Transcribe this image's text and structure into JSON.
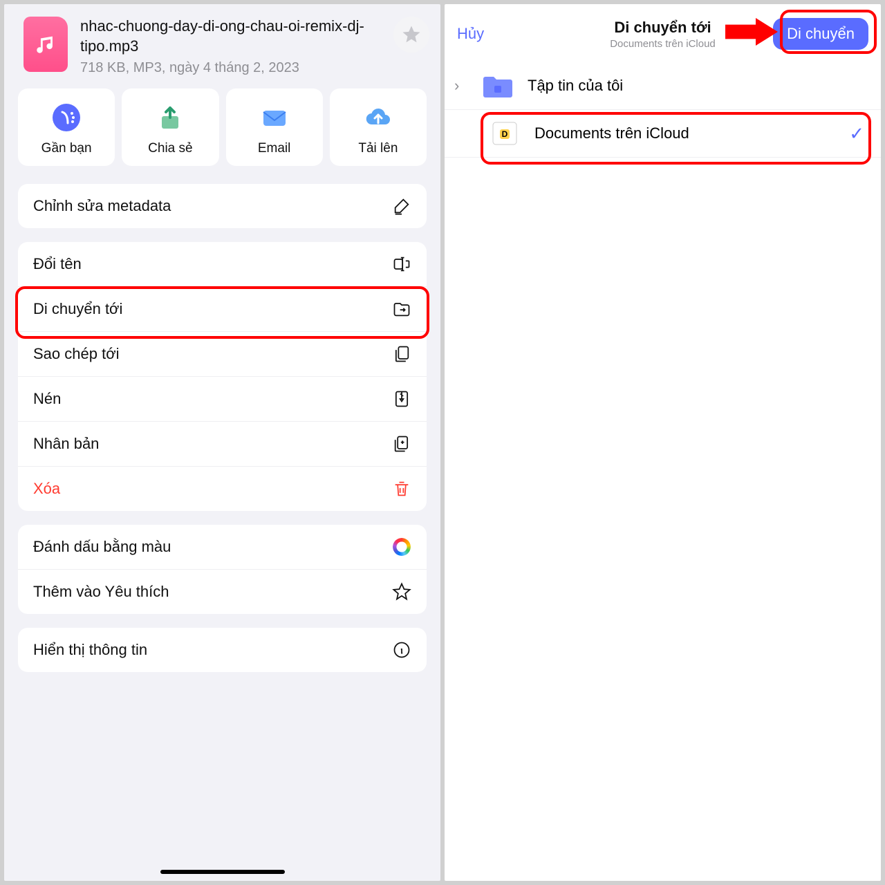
{
  "left": {
    "file": {
      "name": "nhac-chuong-day-di-ong-chau-oi-remix-dj-tipo.mp3",
      "sub": "718 KB, MP3, ngày 4 tháng 2, 2023"
    },
    "actions": {
      "nearby": "Gần bạn",
      "share": "Chia sẻ",
      "email": "Email",
      "upload": "Tải lên"
    },
    "menu": {
      "edit_metadata": "Chỉnh sửa metadata",
      "rename": "Đổi tên",
      "move_to": "Di chuyển tới",
      "copy_to": "Sao chép tới",
      "compress": "Nén",
      "duplicate": "Nhân bản",
      "delete": "Xóa",
      "color_tag": "Đánh dấu bằng màu",
      "favorite": "Thêm vào Yêu thích",
      "info": "Hiển thị thông tin"
    }
  },
  "right": {
    "cancel": "Hủy",
    "title": "Di chuyển tới",
    "subtitle": "Documents trên iCloud",
    "move": "Di chuyển",
    "folders": {
      "myfiles": "Tập tin của tôi",
      "icloud": "Documents trên iCloud"
    }
  }
}
